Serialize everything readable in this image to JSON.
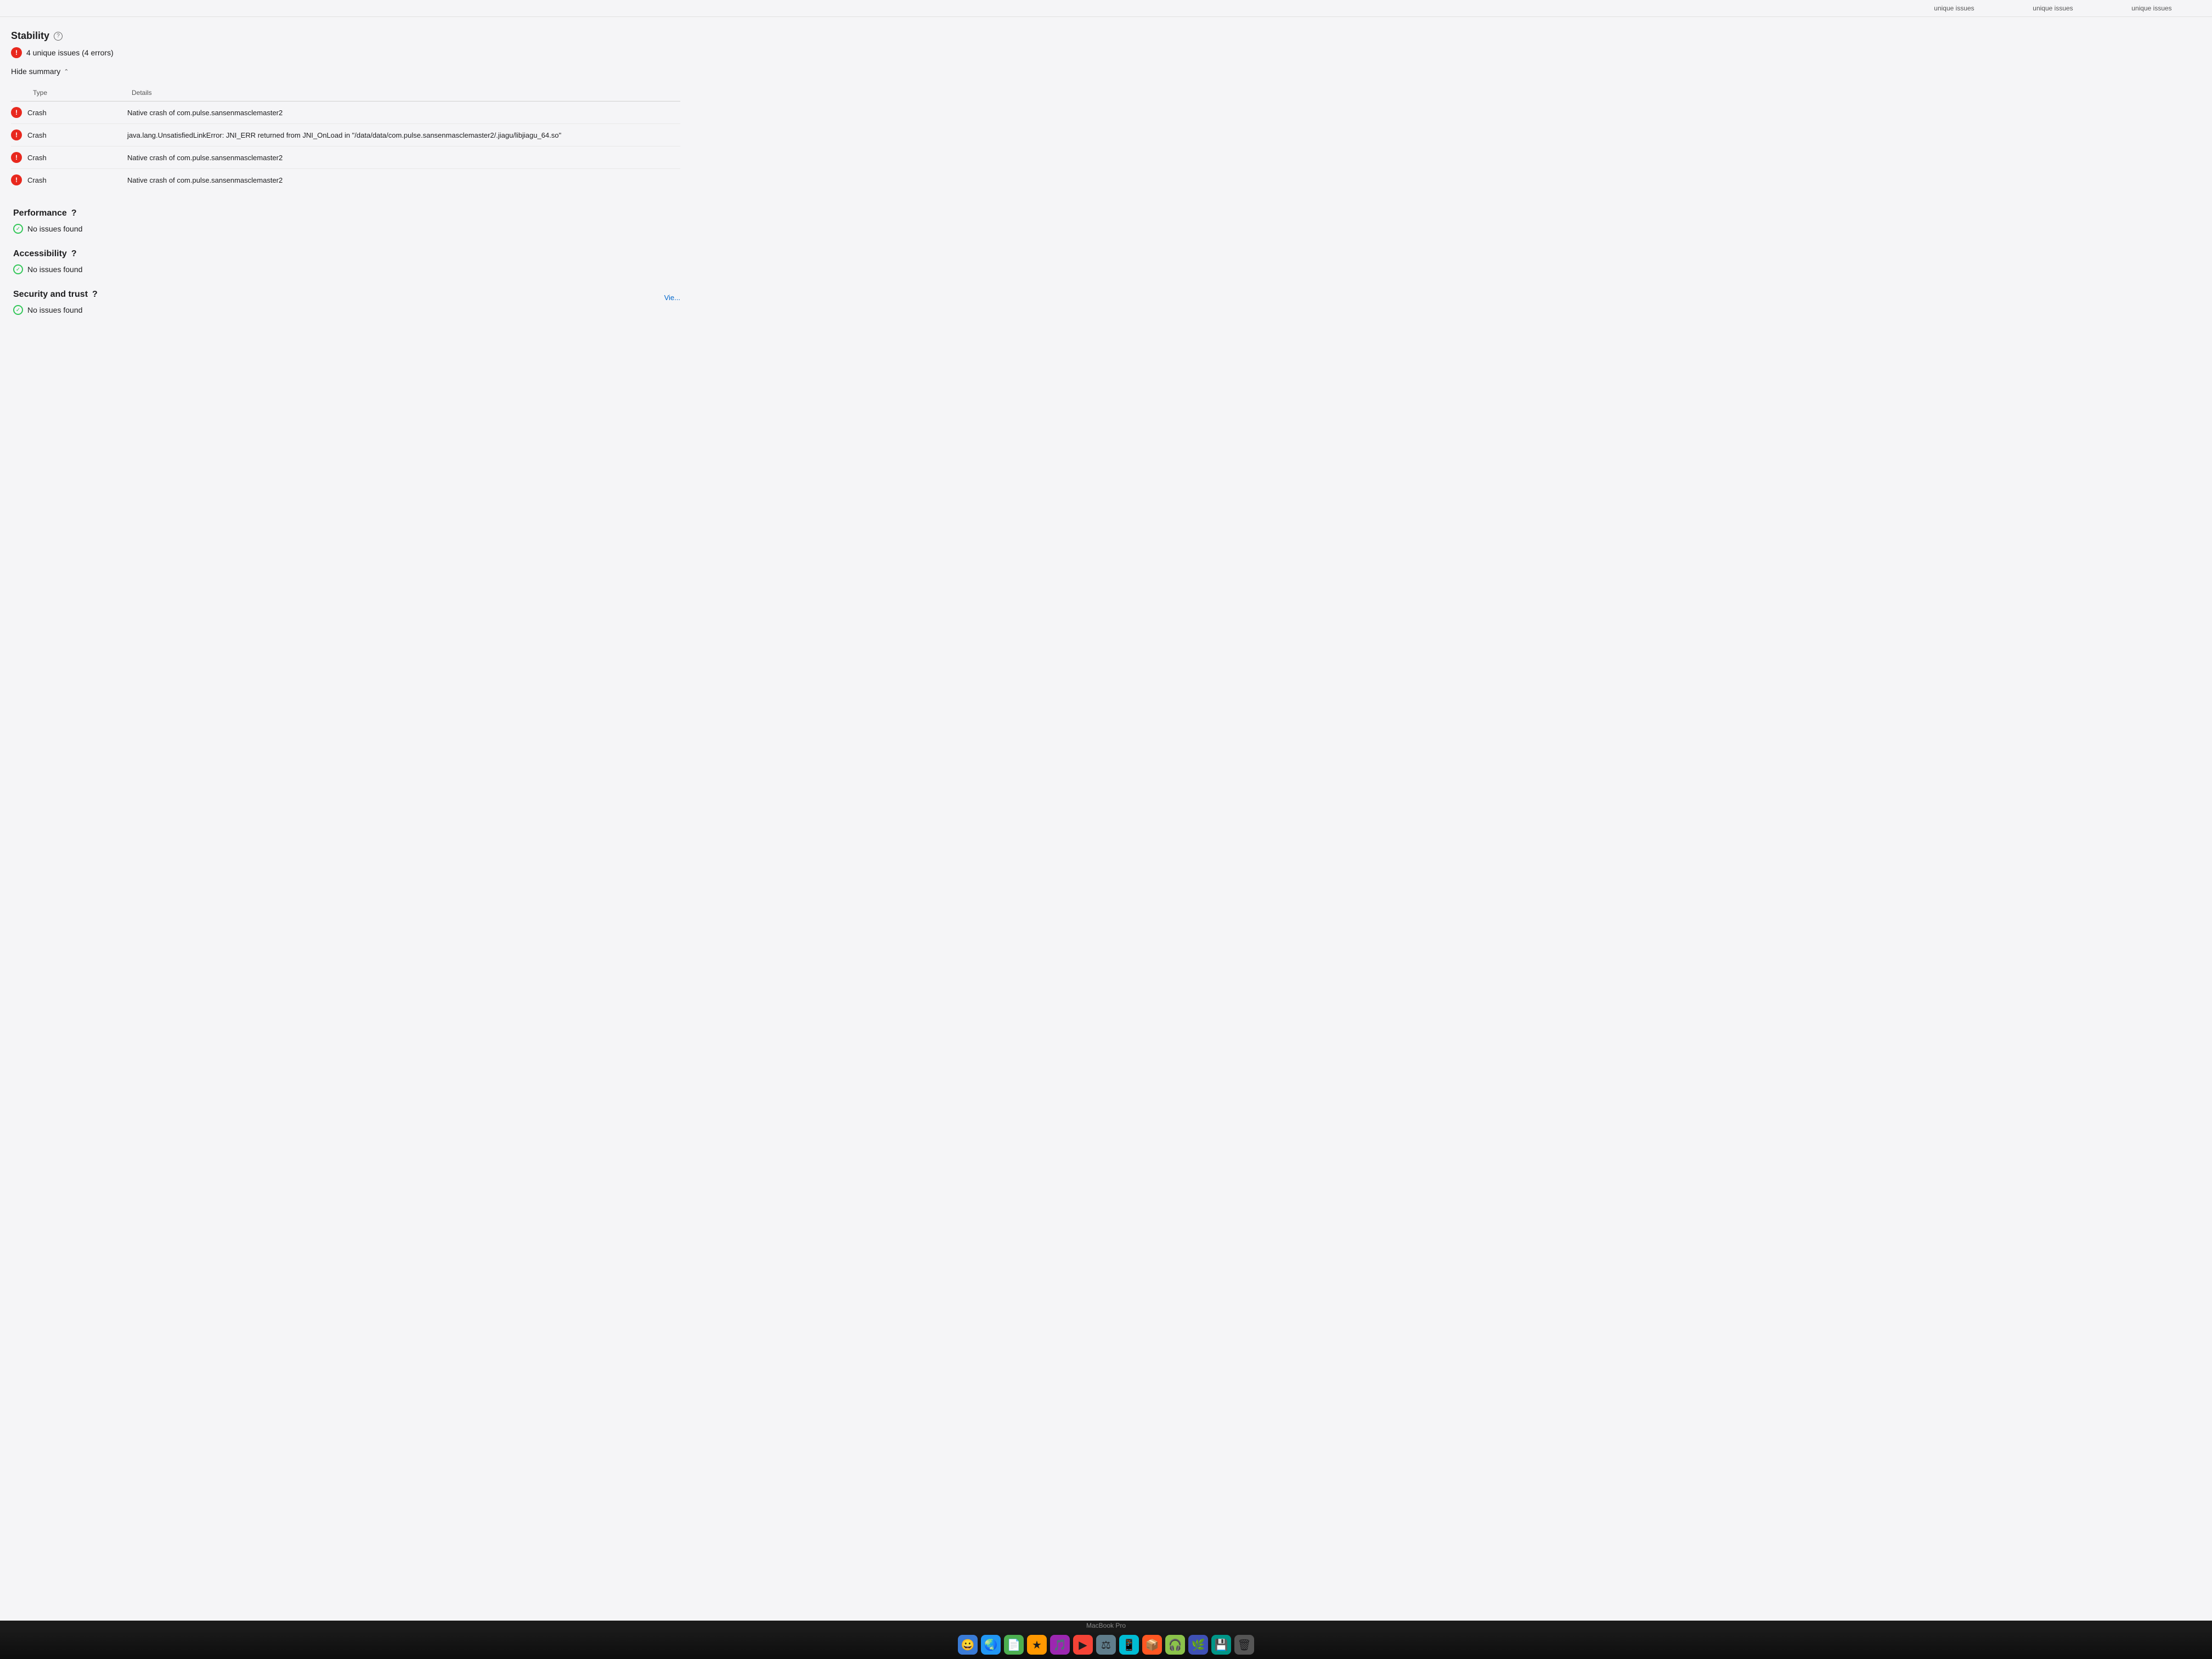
{
  "topHeader": {
    "columns": [
      "unique issues",
      "unique issues",
      "unique issues"
    ]
  },
  "stability": {
    "title": "Stability",
    "issueCount": "4 unique issues (4 errors)",
    "toggleLabel": "Hide summary",
    "table": {
      "columns": [
        "Type",
        "Details"
      ],
      "rows": [
        {
          "type": "Crash",
          "details": "Native crash of com.pulse.sansenmasclemaster2"
        },
        {
          "type": "Crash",
          "details": "java.lang.UnsatisfiedLinkError: JNI_ERR returned from JNI_OnLoad in \"/data/data/com.pulse.sansenmasclemaster2/.jiagu/libjiagu_64.so\""
        },
        {
          "type": "Crash",
          "details": "Native crash of com.pulse.sansenmasclemaster2"
        },
        {
          "type": "Crash",
          "details": "Native crash of com.pulse.sansenmasclemaster2"
        }
      ]
    }
  },
  "performance": {
    "title": "Performance",
    "status": "No issues found"
  },
  "accessibility": {
    "title": "Accessibility",
    "status": "No issues found"
  },
  "securityAndTrust": {
    "title": "Security and trust",
    "status": "No issues found",
    "viewLink": "Vie..."
  },
  "dock": {
    "macbookLabel": "MacBook Pro"
  }
}
